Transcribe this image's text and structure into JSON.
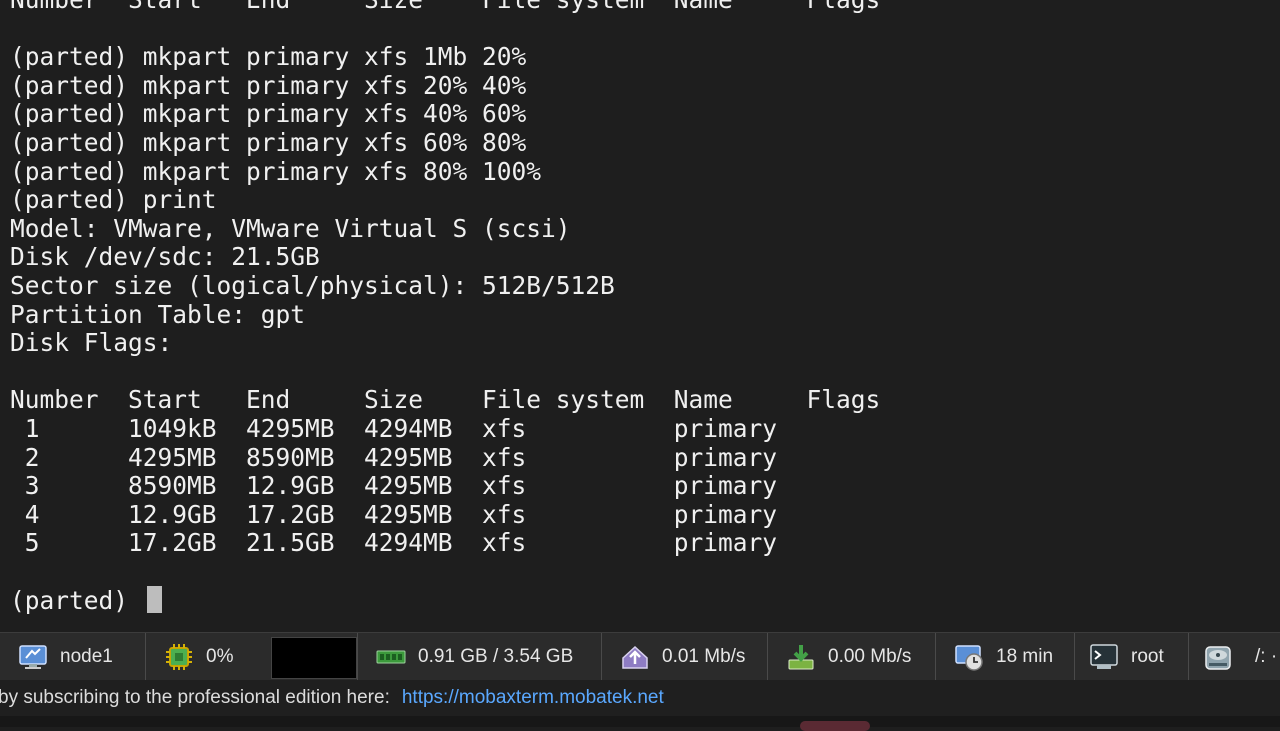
{
  "terminal": {
    "lines": [
      "Number  Start   End     Size    File system  Name     Flags",
      "",
      "(parted) mkpart primary xfs 1Mb 20%",
      "(parted) mkpart primary xfs 20% 40%",
      "(parted) mkpart primary xfs 40% 60%",
      "(parted) mkpart primary xfs 60% 80%",
      "(parted) mkpart primary xfs 80% 100%",
      "(parted) print",
      "Model: VMware, VMware Virtual S (scsi)",
      "Disk /dev/sdc: 21.5GB",
      "Sector size (logical/physical): 512B/512B",
      "Partition Table: gpt",
      "Disk Flags:",
      "",
      "Number  Start   End     Size    File system  Name     Flags",
      " 1      1049kB  4295MB  4294MB  xfs          primary",
      " 2      4295MB  8590MB  4295MB  xfs          primary",
      " 3      8590MB  12.9GB  4295MB  xfs          primary",
      " 4      12.9GB  17.2GB  4295MB  xfs          primary",
      " 5      17.2GB  21.5GB  4294MB  xfs          primary",
      ""
    ],
    "prompt": "(parted) "
  },
  "statusbar": {
    "host": "node1",
    "cpu": "0%",
    "memory": "0.91 GB / 3.54 GB",
    "upload": "0.01 Mb/s",
    "download": "0.00 Mb/s",
    "uptime": "18 min",
    "user": "root",
    "disk": "/: ·"
  },
  "infobar": {
    "message": "by subscribing to the professional edition here:",
    "link": "https://mobaxterm.mobatek.net"
  }
}
